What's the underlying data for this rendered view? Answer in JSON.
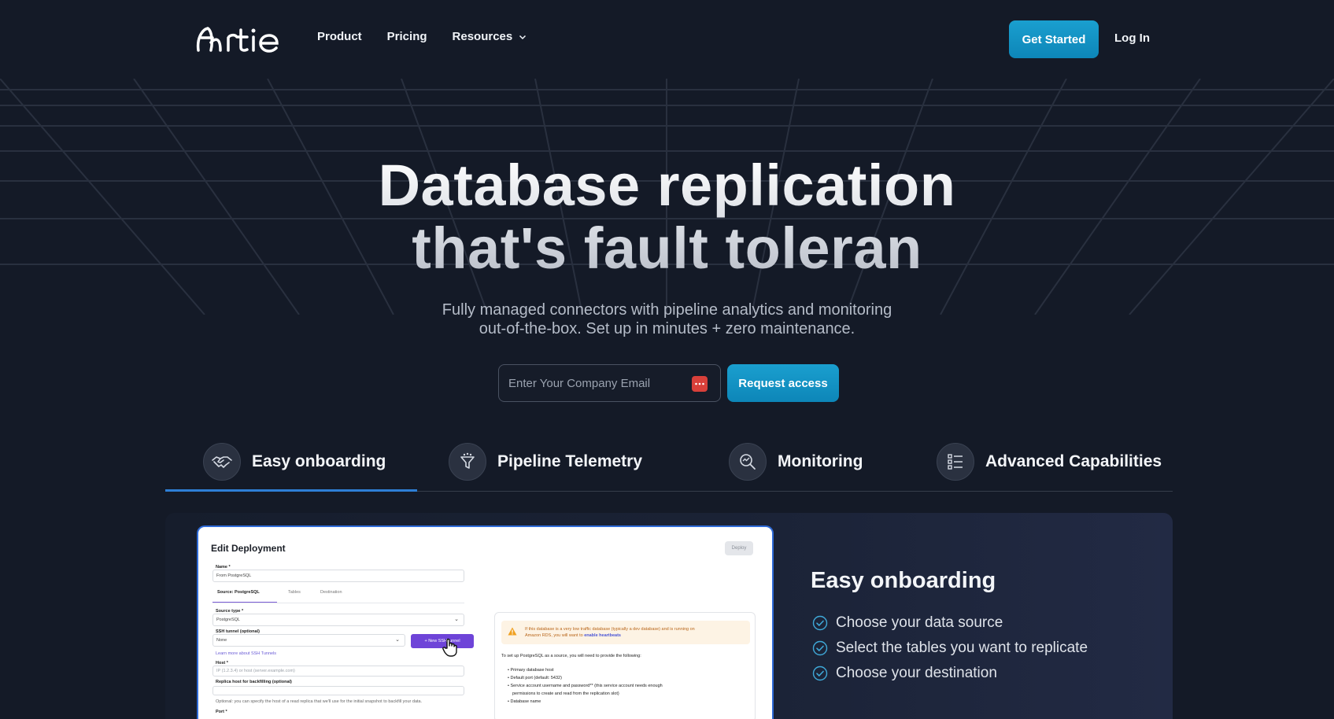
{
  "header": {
    "logo_text": "Artie",
    "nav": [
      {
        "label": "Product"
      },
      {
        "label": "Pricing"
      },
      {
        "label": "Resources",
        "icon": "chevron-down-icon"
      }
    ],
    "cta_label": "Get Started",
    "login_label": "Log In"
  },
  "hero": {
    "title_line1": "Database replication",
    "title_line2": "that's fault toleran",
    "subtitle_line1": "Fully managed connectors with pipeline analytics and monitoring",
    "subtitle_line2": "out-of-the-box. Set up in minutes + zero maintenance.",
    "email_placeholder": "Enter Your Company Email",
    "email_value": "",
    "request_label": "Request access"
  },
  "tabs": [
    {
      "label": "Easy onboarding",
      "icon": "handshake-icon",
      "active": true
    },
    {
      "label": "Pipeline Telemetry",
      "icon": "funnel-icon",
      "active": false
    },
    {
      "label": "Monitoring",
      "icon": "magnifier-chart-icon",
      "active": false
    },
    {
      "label": "Advanced Capabilities",
      "icon": "list-icon",
      "active": false
    }
  ],
  "screenshot": {
    "title": "Edit Deployment",
    "deploy_label": "Deploy",
    "name_label": "Name *",
    "name_value": "From PostgreSQL",
    "subtabs": [
      "Source: PostgreSQL",
      "Tables",
      "Destination"
    ],
    "source_type_label": "Source type *",
    "source_type_value": "PostgreSQL",
    "ssh_label": "SSH tunnel (optional)",
    "ssh_value": "None",
    "new_ssh_label": "+ New SSH tunnel",
    "ssh_link": "Learn more about SSH Tunnels",
    "host_label": "Host *",
    "host_placeholder": "IP (1.2.3.4) or host (server.example.com)",
    "replica_label": "Replica host for backfilling (optional)",
    "replica_note": "Optional: you can specify the host of a read replica that we'll use for the initial snapshot to backfill your data.",
    "port_label": "Port *",
    "warning_text_1": "If this database is a very low traffic database (typically a dev database) and is running on",
    "warning_text_2": "Amazon RDS, you will want to",
    "warning_link": "enable heartbeats",
    "setup_intro": "To set up PostgreSQL as a source, you will need to provide the following:",
    "setup_items": [
      "Primary database host",
      "Default port (default: 5432)",
      "Service account username and password** (this service account needs enough",
      "permissions to create and read from the replication slot)",
      "Database name"
    ]
  },
  "feature_panel": {
    "title": "Easy onboarding",
    "items": [
      "Choose your data source",
      "Select the tables you want to replicate",
      "Choose your destination"
    ]
  },
  "colors": {
    "background": "#141a27",
    "accent": "#1a9fcf",
    "tab_underline": "#2e7fd6",
    "check": "#3fa9d8"
  }
}
